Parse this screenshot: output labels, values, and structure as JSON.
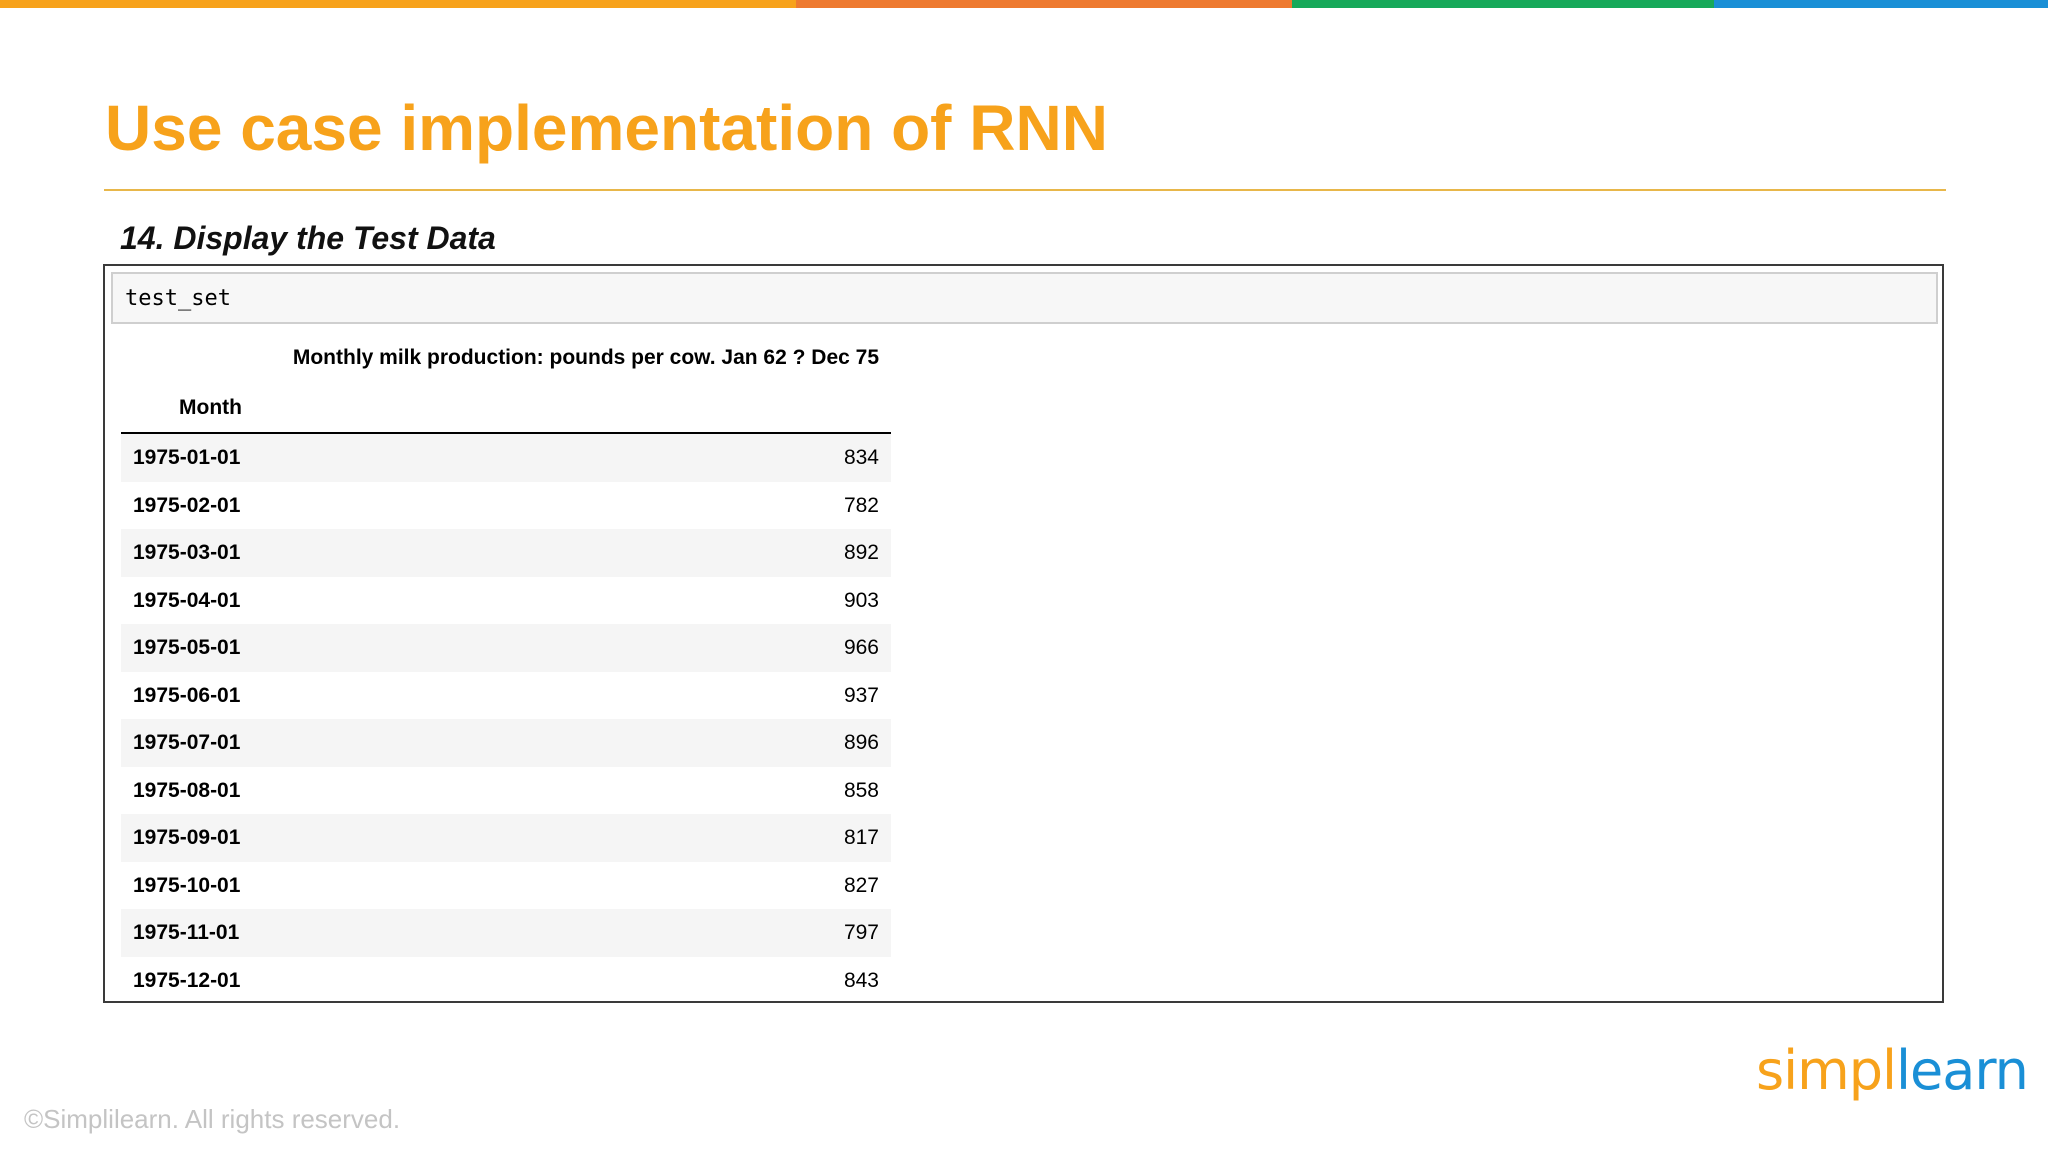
{
  "colors": {
    "accent_orange": "#F7A21B",
    "bar_segments": [
      "#F7A21B",
      "#EE7A30",
      "#17A95A",
      "#1A8FD6"
    ],
    "rule": "#E8B74A",
    "logo_left": "#F7A21B",
    "logo_right": "#1A8FD6"
  },
  "slide": {
    "title": "Use case implementation of RNN",
    "subtitle": "14. Display the Test Data",
    "copyright": "©Simplilearn. All rights reserved."
  },
  "notebook": {
    "code": "test_set",
    "table": {
      "column_title": "Monthly milk production: pounds per cow. Jan 62 ? Dec 75",
      "index_name": "Month",
      "rows": [
        {
          "month": "1975-01-01",
          "value": "834"
        },
        {
          "month": "1975-02-01",
          "value": "782"
        },
        {
          "month": "1975-03-01",
          "value": "892"
        },
        {
          "month": "1975-04-01",
          "value": "903"
        },
        {
          "month": "1975-05-01",
          "value": "966"
        },
        {
          "month": "1975-06-01",
          "value": "937"
        },
        {
          "month": "1975-07-01",
          "value": "896"
        },
        {
          "month": "1975-08-01",
          "value": "858"
        },
        {
          "month": "1975-09-01",
          "value": "817"
        },
        {
          "month": "1975-10-01",
          "value": "827"
        },
        {
          "month": "1975-11-01",
          "value": "797"
        },
        {
          "month": "1975-12-01",
          "value": "843"
        }
      ]
    }
  },
  "logo": {
    "left": "simpl",
    "right": "learn"
  }
}
